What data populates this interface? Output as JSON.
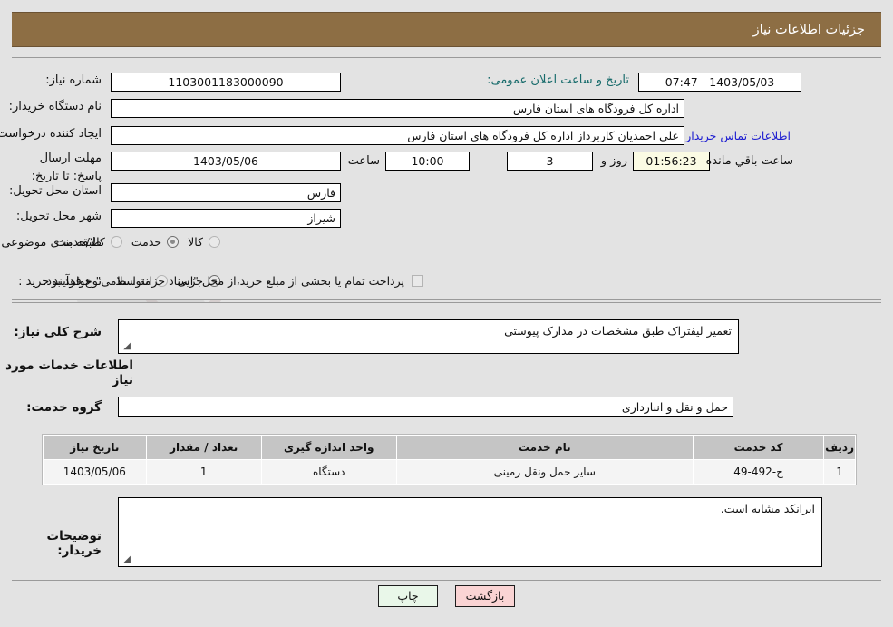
{
  "header": {
    "title": "جزئیات اطلاعات نیاز",
    "bar_color": "#8d6e44"
  },
  "form": {
    "need_number_label": "شماره نیاز:",
    "need_number_value": "1103001183000090",
    "announce_datetime_label": "تاریخ و ساعت اعلان عمومی:",
    "announce_datetime_value": "1403/05/03 - 07:47",
    "buyer_org_label": "نام دستگاه خریدار:",
    "buyer_org_value": "اداره کل فرودگاه های استان فارس",
    "creator_label": "ایجاد کننده درخواست:",
    "creator_value": "علی  احمدیان کاربرداز اداره کل فرودگاه های استان فارس",
    "contact_link": "اطلاعات تماس خریدار",
    "deadline_label": "مهلت ارسال پاسخ: تا تاریخ:",
    "deadline_date": "1403/05/06",
    "hour_label": "ساعت",
    "hour_value": "10:00",
    "days_value": "3",
    "days_label": "روز و",
    "countdown_value": "01:56:23",
    "countdown_label": "ساعت باقي مانده",
    "province_label": "استان محل تحویل:",
    "province_value": "فارس",
    "city_label": "شهر محل تحویل:",
    "city_value": "شیراز",
    "category_label": "طبقه بندی موضوعی:",
    "category_options": [
      {
        "label": "کالا",
        "selected": false
      },
      {
        "label": "خدمت",
        "selected": true
      },
      {
        "label": "کالا/خدمت",
        "selected": false
      }
    ],
    "process_label": "نوع فرآیند خرید :",
    "process_options": [
      {
        "label": "جزیی",
        "selected": true
      },
      {
        "label": "متوسط",
        "selected": false
      }
    ],
    "payment_checkbox_label": "پرداخت تمام یا بخشی از مبلغ خرید،از محل \"اسناد خزانه اسلامی\" خواهد بود.",
    "payment_checked": false
  },
  "description": {
    "label": "شرح کلی نیاز:",
    "value": "تعمیر لیفتراک طبق مشخصات در مدارک پیوستی"
  },
  "services_section": {
    "heading": "اطلاعات خدمات مورد نیاز",
    "group_label": "گروه خدمت:",
    "group_value": "حمل و نقل و انبارداری"
  },
  "table": {
    "columns": [
      "ردیف",
      "کد خدمت",
      "نام خدمت",
      "واحد اندازه گیری",
      "تعداد / مقدار",
      "تاریخ نیاز"
    ],
    "rows": [
      {
        "row_no": "1",
        "service_code": "ح-492-49",
        "service_name": "سایر حمل ونقل زمینی",
        "unit": "دستگاه",
        "quantity": "1",
        "need_date": "1403/05/06"
      }
    ]
  },
  "buyer_notes": {
    "label": "توضیحات خریدار:",
    "value": "ایرانکد مشابه است."
  },
  "footer": {
    "print_button": "چاپ",
    "back_button": "بازگشت"
  },
  "watermark": {
    "text": "AriaTender.net"
  }
}
